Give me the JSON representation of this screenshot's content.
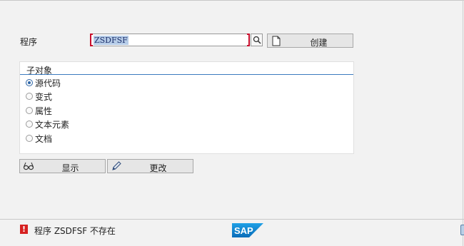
{
  "form": {
    "program_label": "程序",
    "program_value": "ZSDFSF",
    "create_label": "创建"
  },
  "subobjects": {
    "title": "子对象",
    "options": [
      {
        "label": "源代码",
        "selected": true
      },
      {
        "label": "变式",
        "selected": false
      },
      {
        "label": "属性",
        "selected": false
      },
      {
        "label": "文本元素",
        "selected": false
      },
      {
        "label": "文档",
        "selected": false
      }
    ]
  },
  "actions": {
    "display_label": "显示",
    "change_label": "更改"
  },
  "status": {
    "message": "程序 ZSDFSF 不存在",
    "error_symbol": "!",
    "logo_text": "SAP"
  },
  "colors": {
    "error": "#d62020",
    "accent": "#2e66a8",
    "selection": "#b7cde8"
  }
}
